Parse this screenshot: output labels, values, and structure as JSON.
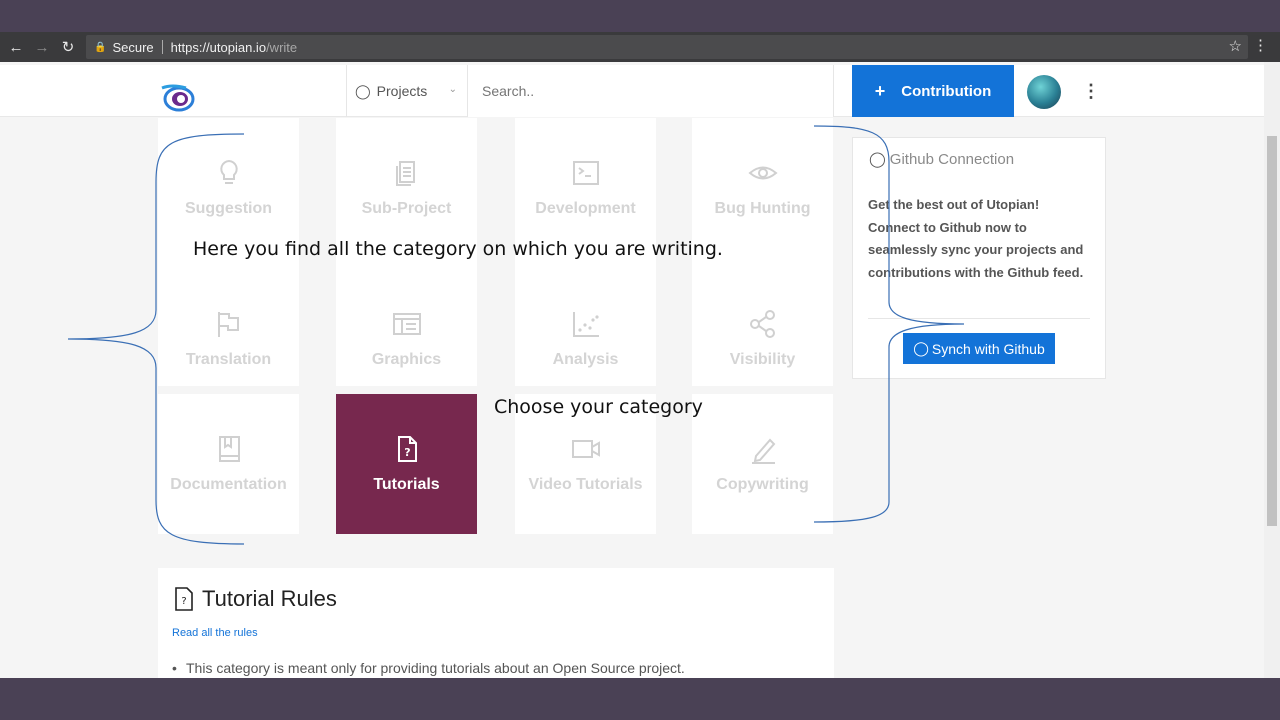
{
  "browser": {
    "security_label": "Secure",
    "url_host": "https://utopian.io",
    "url_path": "/write"
  },
  "header": {
    "projects_label": "Projects",
    "search_placeholder": "Search..",
    "contribution_label": "Contribution",
    "contribution_plus": "+"
  },
  "categories": [
    {
      "label": "Suggestion",
      "icon": "lightbulb-icon"
    },
    {
      "label": "Sub-Project",
      "icon": "document-stack-icon"
    },
    {
      "label": "Development",
      "icon": "terminal-icon"
    },
    {
      "label": "Bug Hunting",
      "icon": "eye-icon"
    },
    {
      "label": "Translation",
      "icon": "flag-icon"
    },
    {
      "label": "Graphics",
      "icon": "graphics-icon"
    },
    {
      "label": "Analysis",
      "icon": "scatter-chart-icon"
    },
    {
      "label": "Visibility",
      "icon": "share-icon"
    },
    {
      "label": "Documentation",
      "icon": "book-icon"
    },
    {
      "label": "Tutorials",
      "icon": "question-document-icon",
      "selected": true
    },
    {
      "label": "Video Tutorials",
      "icon": "video-camera-icon"
    },
    {
      "label": "Copywriting",
      "icon": "pencil-icon"
    }
  ],
  "github_panel": {
    "title": "Github Connection",
    "text": "Get the best out of Utopian! Connect to Github now to seamlessly sync your projects and contributions with the Github feed.",
    "button_label": "Synch with Github"
  },
  "rules": {
    "title": "Tutorial Rules",
    "link": "Read all the rules",
    "bullet": "This category is meant only for providing tutorials about an Open Source project."
  },
  "annotations": {
    "top": "Here you find all the category on which you are writing.",
    "middle": "Choose your category"
  },
  "colors": {
    "accent": "#1373d8",
    "selected_card": "#77284e",
    "frame": "#4a4155"
  }
}
